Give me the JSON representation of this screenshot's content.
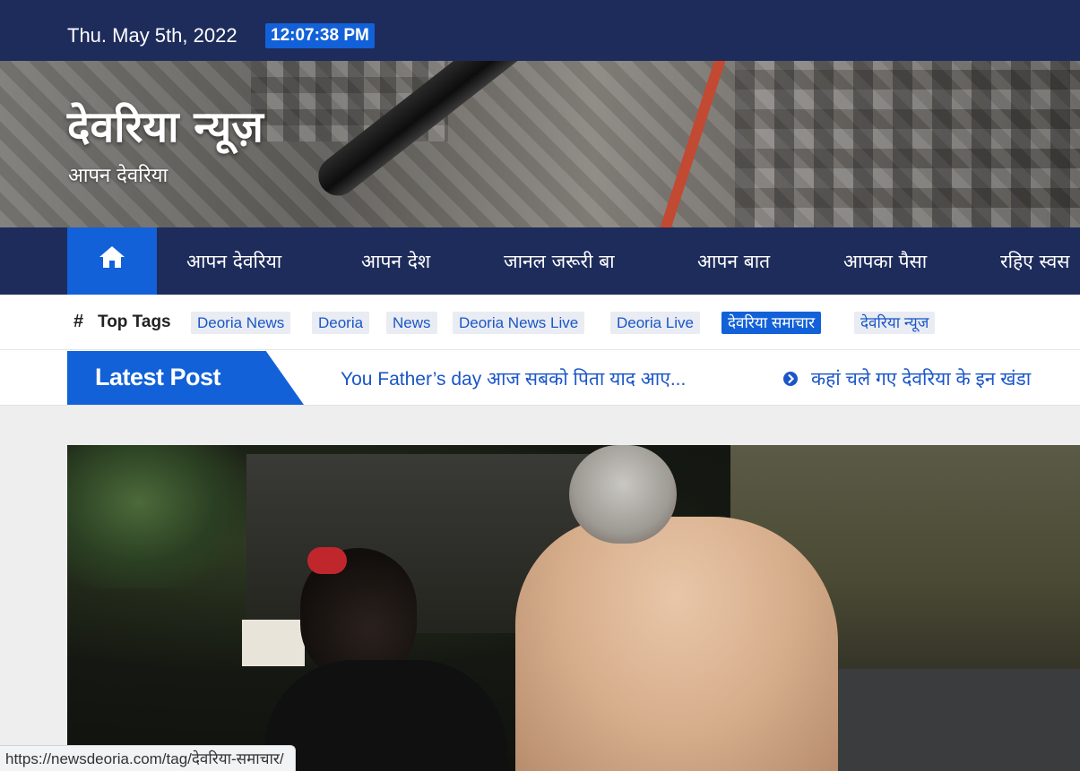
{
  "topbar": {
    "date": "Thu. May 5th, 2022",
    "time": "12:07:38 PM"
  },
  "header": {
    "site_title": "देवरिया न्यूज़",
    "tagline": "आपन देवरिया"
  },
  "nav": {
    "home_icon": "home-icon",
    "items": [
      "आपन देवरिया",
      "आपन देश",
      "जानल जरूरी बा",
      "आपन बात",
      "आपका पैसा",
      "रहिए स्वस"
    ]
  },
  "top_tags": {
    "label": "Top Tags",
    "tags": [
      "Deoria News",
      "Deoria",
      "News",
      "Deoria News Live",
      "Deoria Live",
      "देवरिया समाचार",
      "देवरिया न्यूज"
    ],
    "active_index": 5
  },
  "latest_post": {
    "label": "Latest Post",
    "posts": [
      "You Father’s day आज सबको पिता याद आए...",
      "कहां चले गए देवरिया के इन खंडा"
    ]
  },
  "status_bar": {
    "url": "https://newsdeoria.com/tag/देवरिया-समाचार/"
  },
  "colors": {
    "navy": "#1e2c5c",
    "accent_blue": "#1261d8",
    "link_blue": "#1a56c8"
  }
}
